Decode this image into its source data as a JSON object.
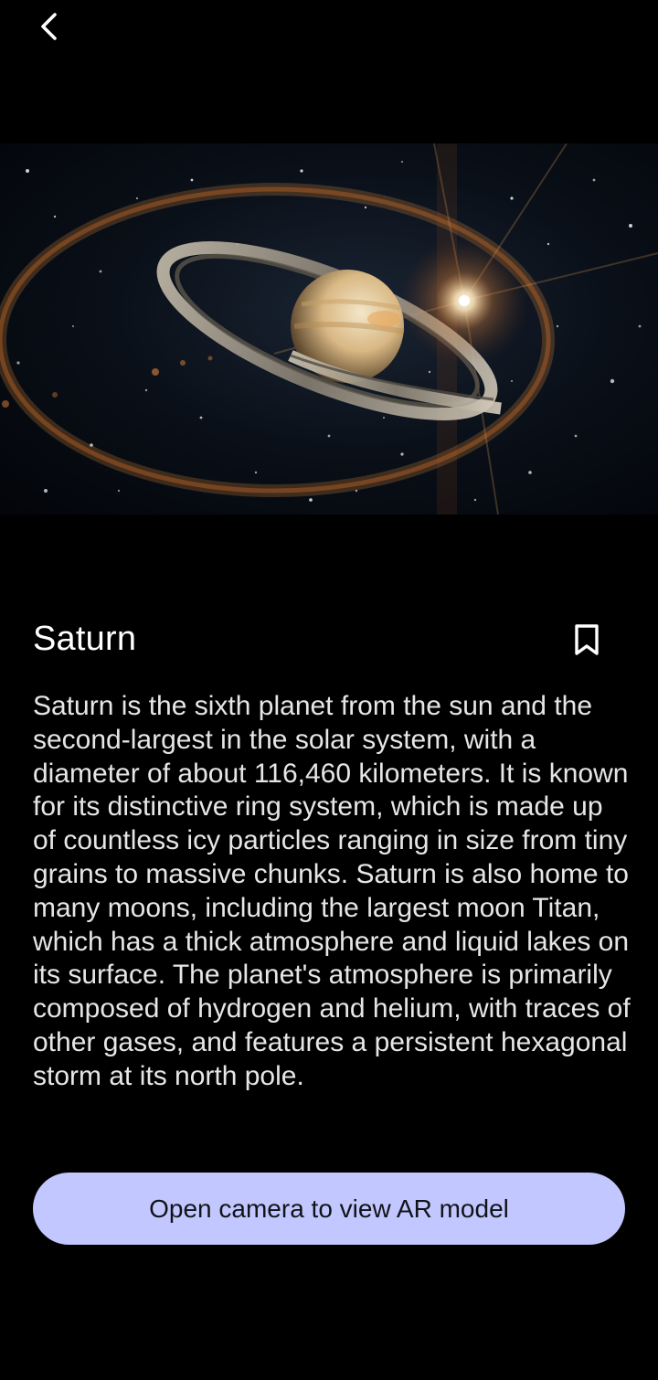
{
  "header": {
    "back_icon": "chevron-left-icon"
  },
  "hero": {
    "image": "saturn-space-illustration"
  },
  "planet": {
    "name": "Saturn",
    "bookmark_icon": "bookmark-outline-icon",
    "description": "Saturn is the sixth planet from the sun and the second-largest in the solar system, with a diameter of about 116,460 kilometers. It is known for its distinctive ring system, which is made up of countless icy particles ranging in size from tiny grains to massive chunks. Saturn is also home to many moons, including the largest moon Titan, which has a thick atmosphere and liquid lakes on its surface. The planet's atmosphere is primarily composed of hydrogen and helium, with traces of other gases, and features a persistent hexagonal storm at its north pole."
  },
  "actions": {
    "ar_button_label": "Open camera to view AR model"
  },
  "colors": {
    "background": "#000000",
    "button_background": "#c2c8ff",
    "button_text": "#111318",
    "text_primary": "#ffffff"
  }
}
